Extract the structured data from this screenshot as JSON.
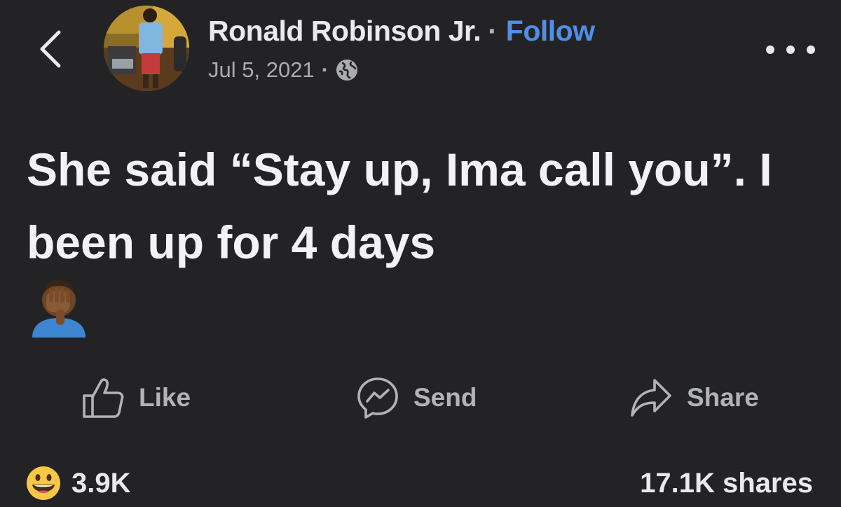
{
  "header": {
    "author_name": "Ronald Robinson Jr.",
    "separator": "·",
    "follow_label": "Follow",
    "date": "Jul 5, 2021",
    "meta_separator": "·",
    "privacy_icon": "globe-icon",
    "back_icon": "chevron-left-icon",
    "more_icon": "more-horizontal-icon"
  },
  "post": {
    "text": "She said “Stay up, Ima call you”. I been up for 4 days",
    "emoji": "facepalm-emoji"
  },
  "actions": {
    "like_label": "Like",
    "send_label": "Send",
    "share_label": "Share"
  },
  "stats": {
    "reaction_icon": "grinning-face-emoji",
    "reactions_count": "3.9K",
    "shares_text": "17.1K shares"
  },
  "colors": {
    "background": "#232325",
    "follow_blue": "#4f8fe6",
    "muted_text": "#b0b3b8",
    "primary_text": "#f2f3f5"
  }
}
